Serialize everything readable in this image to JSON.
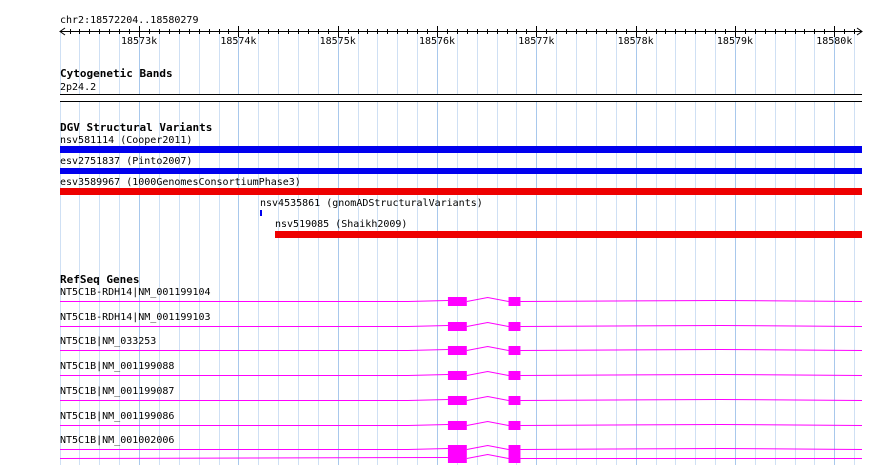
{
  "region": {
    "label": "chr2:18572204..18580279",
    "start": 18572204,
    "end": 18580279
  },
  "ruler": {
    "ticks": [
      "18573k",
      "18574k",
      "18575k",
      "18576k",
      "18577k",
      "18578k",
      "18579k",
      "18580k"
    ]
  },
  "tracks": {
    "cytoband": {
      "title": "Cytogenetic Bands",
      "band": "2p24.2"
    },
    "dgv": {
      "title": "DGV Structural Variants",
      "features": [
        {
          "name": "nsv581114",
          "source": "(Cooper2011)",
          "label": "nsv581114 (Cooper2011)",
          "color": "#0000ee",
          "start": 18572204,
          "end": 18580279
        },
        {
          "name": "esv2751837",
          "source": "(Pinto2007)",
          "label": "esv2751837 (Pinto2007)",
          "color": "#0000ee",
          "start": 18572204,
          "end": 18580279
        },
        {
          "name": "esv3589967",
          "source": "(1000GenomesConsortiumPhase3)",
          "label": "esv3589967 (1000GenomesConsortiumPhase3)",
          "color": "#ee0000",
          "start": 18572204,
          "end": 18580279
        },
        {
          "name": "nsv4535861",
          "source": "(gnomADStructuralVariants)",
          "label": "nsv4535861 (gnomADStructuralVariants)",
          "color": "#0000ee",
          "start": 18574220,
          "end": 18574240
        },
        {
          "name": "nsv519085",
          "source": "(Shaikh2009)",
          "label": "nsv519085 (Shaikh2009)",
          "color": "#ee0000",
          "start": 18574370,
          "end": 18580279
        }
      ]
    },
    "refseq": {
      "title": "RefSeq Genes",
      "color": "#ff00ff",
      "transcripts": [
        {
          "label": "NT5C1B-RDH14|NM_001199104"
        },
        {
          "label": "NT5C1B-RDH14|NM_001199103"
        },
        {
          "label": "NT5C1B|NM_033253"
        },
        {
          "label": "NT5C1B|NM_001199088"
        },
        {
          "label": "NT5C1B|NM_001199087"
        },
        {
          "label": "NT5C1B|NM_001199086"
        },
        {
          "label": "NT5C1B|NM_001002006"
        }
      ]
    }
  }
}
